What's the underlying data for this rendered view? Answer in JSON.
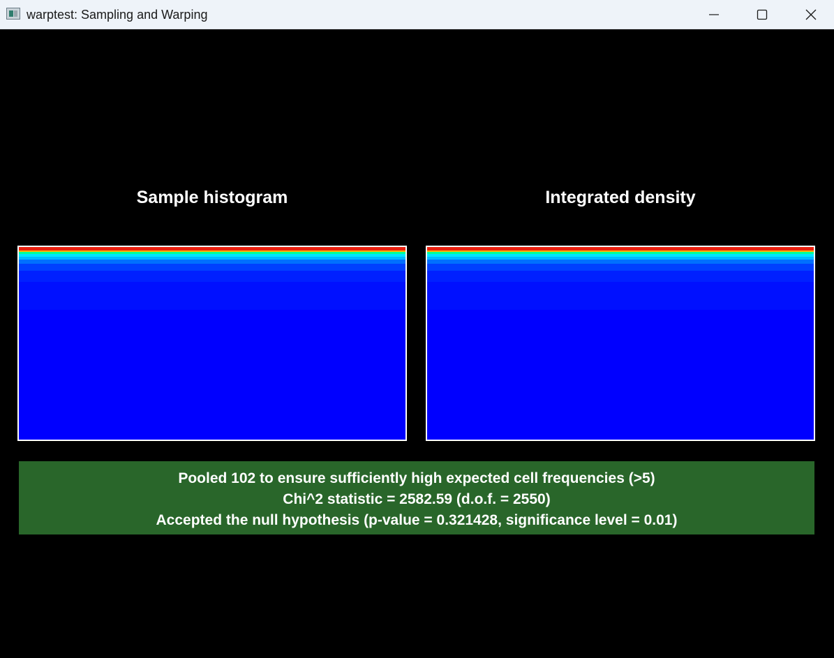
{
  "window": {
    "title": "warptest: Sampling and Warping",
    "icon": "app-window-icon",
    "controls": [
      "minimize-icon",
      "maximize-icon",
      "close-icon"
    ]
  },
  "panels": {
    "left": {
      "title": "Sample histogram"
    },
    "right": {
      "title": "Integrated density"
    }
  },
  "heatmap_colors": {
    "top_band": "#e8200e",
    "gradient": [
      "#e8200e",
      "#ffb000",
      "#00ff9a",
      "#00e6ff",
      "#00b8ff",
      "#0070ff",
      "#0030ff",
      "#0000ff"
    ],
    "background": "#0000ff",
    "frame": "#ffffff"
  },
  "result": {
    "line1": "Pooled 102 to ensure sufficiently high expected cell frequencies (>5)",
    "line2": "Chi^2 statistic = 2582.59 (d.o.f. = 2550)",
    "line3": "Accepted the null hypothesis (p-value = 0.321428, significance level = 0.01)",
    "status_color": "#29662a"
  }
}
